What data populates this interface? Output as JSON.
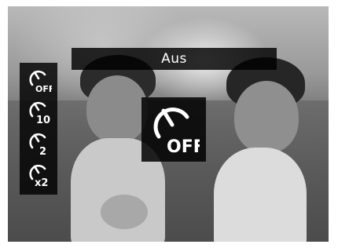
{
  "screen": {
    "selected_mode_label": "Aus"
  },
  "self_timer_menu": {
    "items": [
      {
        "icon": "self-timer-off-icon",
        "label": "OFF",
        "selected": true
      },
      {
        "icon": "self-timer-10s-icon",
        "label": "10"
      },
      {
        "icon": "self-timer-2s-icon",
        "label": "2"
      },
      {
        "icon": "self-timer-double-icon",
        "label": "x2"
      }
    ]
  },
  "preview": {
    "icon": "self-timer-off-icon",
    "label": "OFF"
  }
}
